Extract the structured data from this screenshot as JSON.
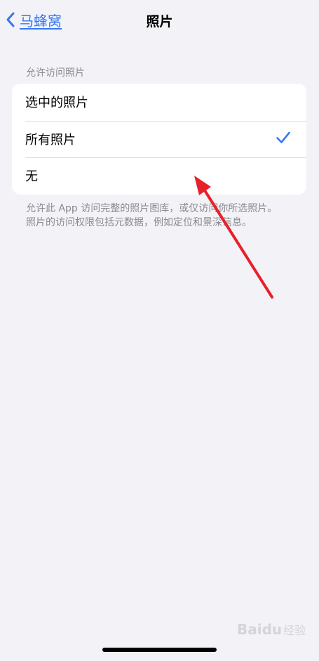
{
  "nav": {
    "back_label": "马蜂窝",
    "title": "照片"
  },
  "section": {
    "header": "允许访问照片",
    "options": [
      {
        "label": "选中的照片",
        "selected": false
      },
      {
        "label": "所有照片",
        "selected": true
      },
      {
        "label": "无",
        "selected": false
      }
    ],
    "footer": "允许此 App 访问完整的照片图库，或仅访问你所选照片。照片的访问权限包括元数据，例如定位和景深信息。"
  },
  "watermark": {
    "brand": "Baidu",
    "sub": "经验"
  },
  "colors": {
    "accent": "#3478f6",
    "background": "#f2f2f7",
    "annotation": "#e8202a"
  },
  "icons": {
    "back": "chevron-left-icon",
    "selected": "checkmark-icon",
    "annotation": "red-arrow"
  }
}
